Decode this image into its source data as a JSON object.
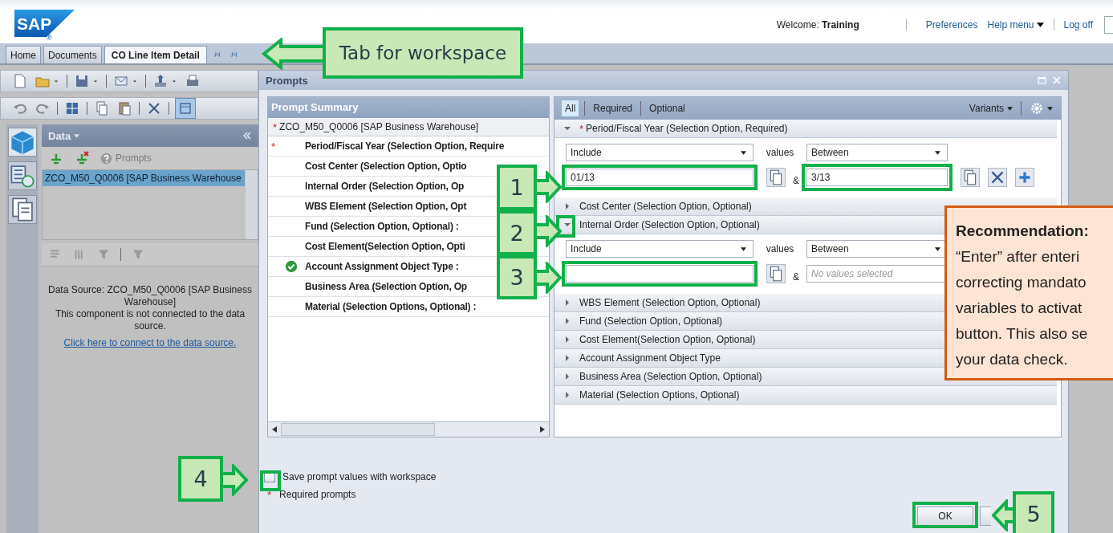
{
  "header": {
    "logo": "SAP",
    "logo_mark": "®",
    "welcome_label": "Welcome:",
    "user": "Training",
    "links": [
      {
        "label": "Preferences",
        "has_menu": false
      },
      {
        "label": "Help menu",
        "has_menu": true
      },
      {
        "label": "Log off",
        "has_menu": false
      }
    ]
  },
  "tabs": [
    {
      "label": "Home",
      "selected": false
    },
    {
      "label": "Documents",
      "selected": false
    },
    {
      "label": "CO Line Item Detail",
      "selected": true
    }
  ],
  "data_panel": {
    "title": "Data",
    "prompts_label": "Prompts",
    "sources": [
      {
        "label": "ZCO_M50_Q0006 [SAP Business Warehouse",
        "selected": true
      }
    ],
    "source_text": "Data Source: ZCO_M50_Q0006 [SAP Business Warehouse]",
    "status_text": "This component is not connected to the data source.",
    "connect_link": "Click here to connect to the data source."
  },
  "dialog": {
    "title": "Prompts",
    "required_mark": "*",
    "summary": {
      "title": "Prompt Summary",
      "source": "ZCO_M50_Q0006 [SAP Business Warehouse]",
      "items": [
        {
          "label": "Period/Fiscal Year (Selection Option, Require",
          "required": true,
          "valid": false
        },
        {
          "label": "Cost Center (Selection Option, Optio",
          "required": false,
          "valid": false
        },
        {
          "label": "Internal Order (Selection Option, Op",
          "required": false,
          "valid": false
        },
        {
          "label": "WBS Element (Selection Option, Opt",
          "required": false,
          "valid": false
        },
        {
          "label": "Fund (Selection Option, Optional) :",
          "required": false,
          "valid": false
        },
        {
          "label": "Cost Element(Selection Option, Opti",
          "required": false,
          "valid": false
        },
        {
          "label": "Account Assignment Object Type :",
          "required": false,
          "valid": true
        },
        {
          "label": "Business Area (Selection Option, Op",
          "required": false,
          "valid": false
        },
        {
          "label": "Material (Selection Options, Optional) :",
          "required": false,
          "valid": false
        }
      ]
    },
    "filters": [
      {
        "label": "All",
        "selected": true
      },
      {
        "label": "Required",
        "selected": false
      },
      {
        "label": "Optional",
        "selected": false
      }
    ],
    "variants_label": "Variants",
    "sections": [
      {
        "title": "Period/Fiscal Year (Selection Option, Required)",
        "required": true,
        "expanded": true,
        "operator": "Include",
        "values_label": "values",
        "range": "Between",
        "from": "01/13",
        "joiner": "&",
        "to": "3/13",
        "row_actions": true
      },
      {
        "title": "Cost Center (Selection Option, Optional)",
        "required": false,
        "expanded": false
      },
      {
        "title": "Internal Order (Selection Option, Optional)",
        "required": false,
        "expanded": true,
        "operator": "Include",
        "values_label": "values",
        "range": "Between",
        "joiner": "&",
        "to_placeholder": "No values selected",
        "row_actions": false
      },
      {
        "title": "WBS Element (Selection Option, Optional)",
        "required": false,
        "expanded": false
      },
      {
        "title": "Fund (Selection Option, Optional)",
        "required": false,
        "expanded": false
      },
      {
        "title": "Cost Element(Selection Option, Optional)",
        "required": false,
        "expanded": false
      },
      {
        "title": "Account Assignment Object Type",
        "required": false,
        "expanded": false
      },
      {
        "title": "Business Area (Selection Option, Optional)",
        "required": false,
        "expanded": false
      },
      {
        "title": "Material (Selection Options, Optional)",
        "required": false,
        "expanded": false
      }
    ],
    "save_option": {
      "label": "Save prompt values with workspace",
      "checked": false
    },
    "legend": "Required prompts",
    "buttons": [
      {
        "kind": "labeled",
        "label": "OK"
      },
      {
        "kind": "covered"
      }
    ]
  },
  "callouts": {
    "workspace": "Tab for workspace",
    "steps": [
      "1",
      "2",
      "3",
      "4",
      "5"
    ],
    "recommendation": {
      "title": "Recommendation:",
      "lines": [
        "“Enter” after enteri",
        "correcting mandato",
        "variables to activat",
        "button. This also se",
        "your data check."
      ]
    }
  }
}
